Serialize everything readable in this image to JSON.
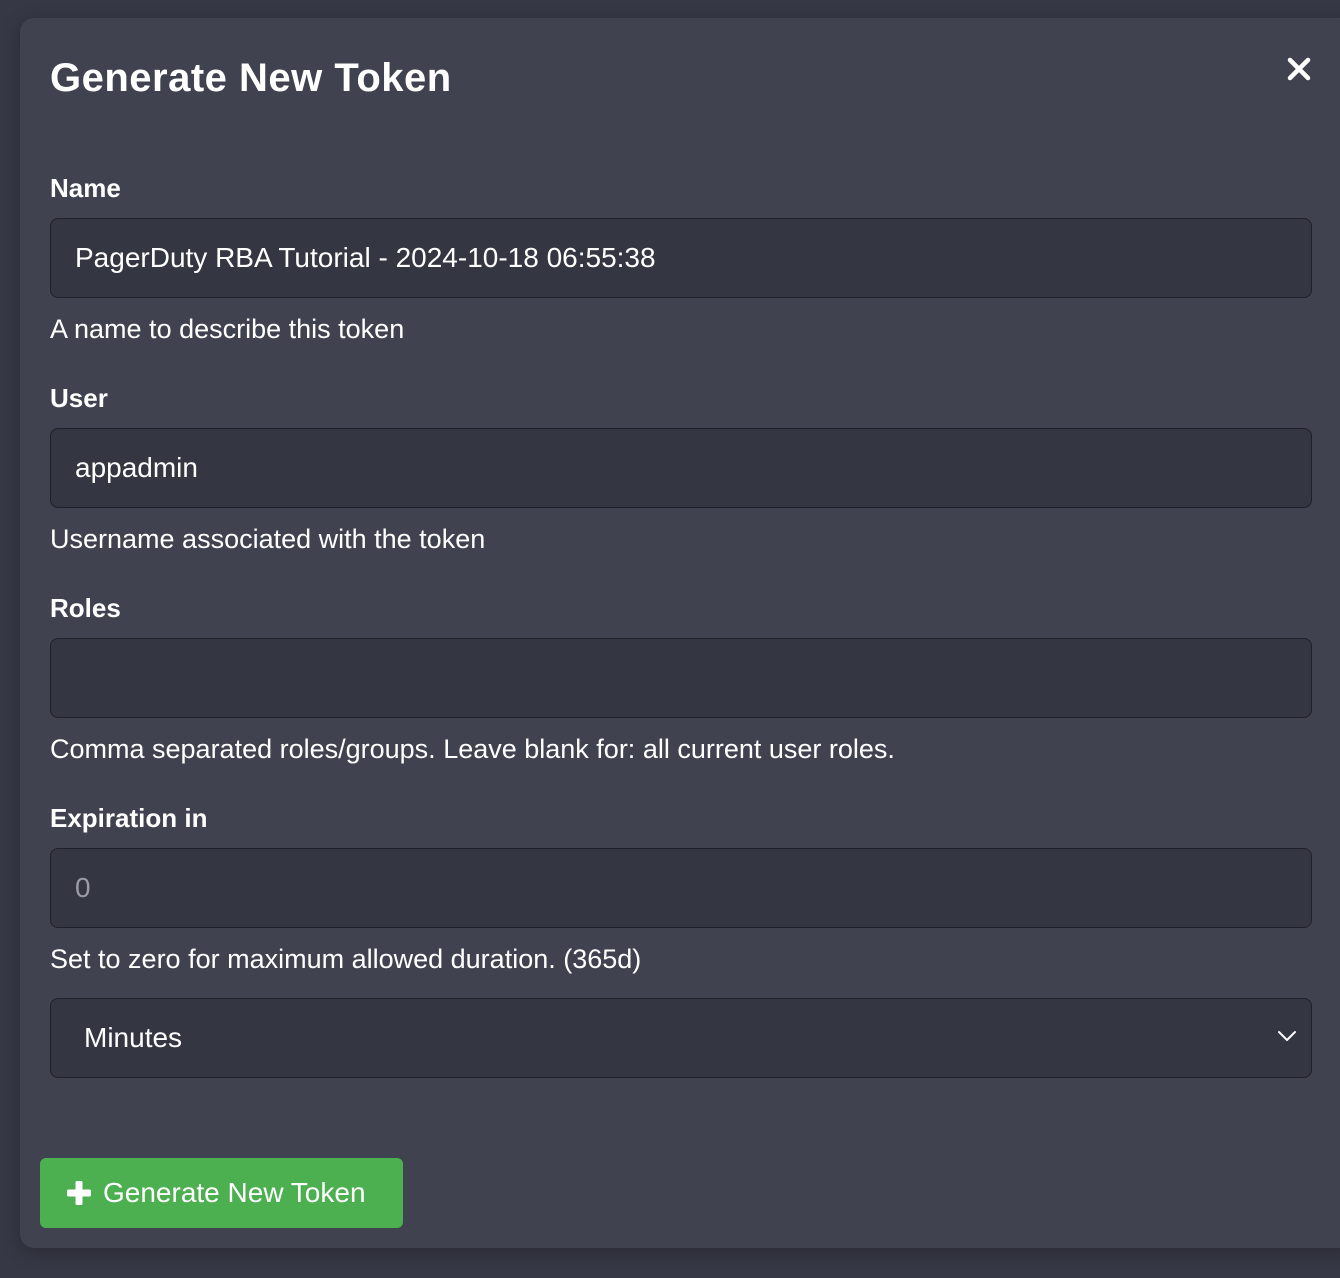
{
  "modal": {
    "title": "Generate New Token"
  },
  "form": {
    "name": {
      "label": "Name",
      "value": "PagerDuty RBA Tutorial - 2024-10-18 06:55:38",
      "help": "A name to describe this token"
    },
    "user": {
      "label": "User",
      "value": "appadmin",
      "help": "Username associated with the token"
    },
    "roles": {
      "label": "Roles",
      "value": "",
      "help": "Comma separated roles/groups. Leave blank for: all current user roles."
    },
    "expiration": {
      "label": "Expiration in",
      "placeholder": "0",
      "help": "Set to zero for maximum allowed duration. (365d)",
      "unit_selected": "Minutes"
    }
  },
  "actions": {
    "generate_label": "Generate New Token"
  },
  "icons": {
    "close": "close-icon",
    "plus": "plus-icon",
    "chevron": "chevron-down-icon"
  },
  "colors": {
    "background": "#363845",
    "modal": "#40424f",
    "field": "#343642",
    "button": "#4caf50"
  }
}
